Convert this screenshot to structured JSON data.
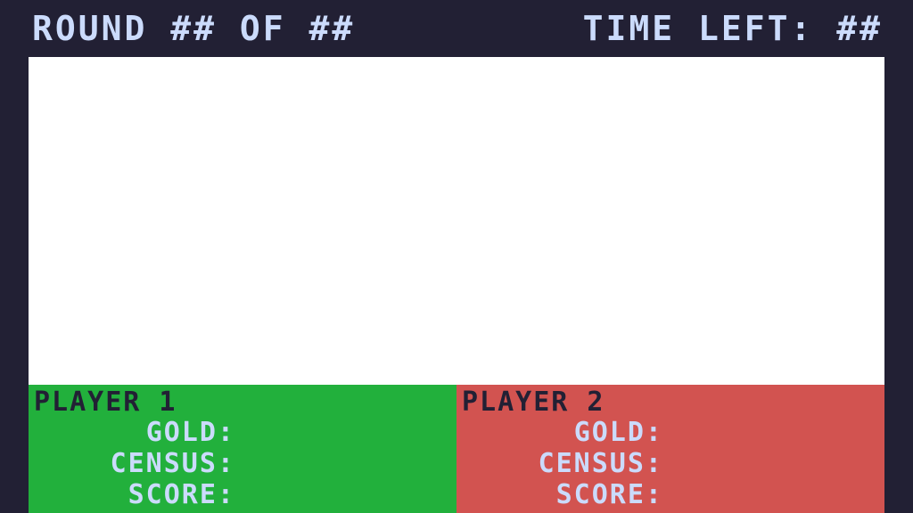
{
  "hud": {
    "round_text": "ROUND ## OF ##",
    "time_text": "TIME LEFT: ##"
  },
  "players": [
    {
      "name": "PLAYER 1",
      "gold_label": "GOLD:",
      "census_label": "CENSUS:",
      "score_label": "SCORE:",
      "color": "#22b03c"
    },
    {
      "name": "PLAYER 2",
      "gold_label": "GOLD:",
      "census_label": "CENSUS:",
      "score_label": "SCORE:",
      "color": "#d25350"
    }
  ],
  "colors": {
    "background": "#222034",
    "game_area": "#ffffff",
    "hud_text": "#cbdbfc",
    "player_name_text": "#222034"
  }
}
